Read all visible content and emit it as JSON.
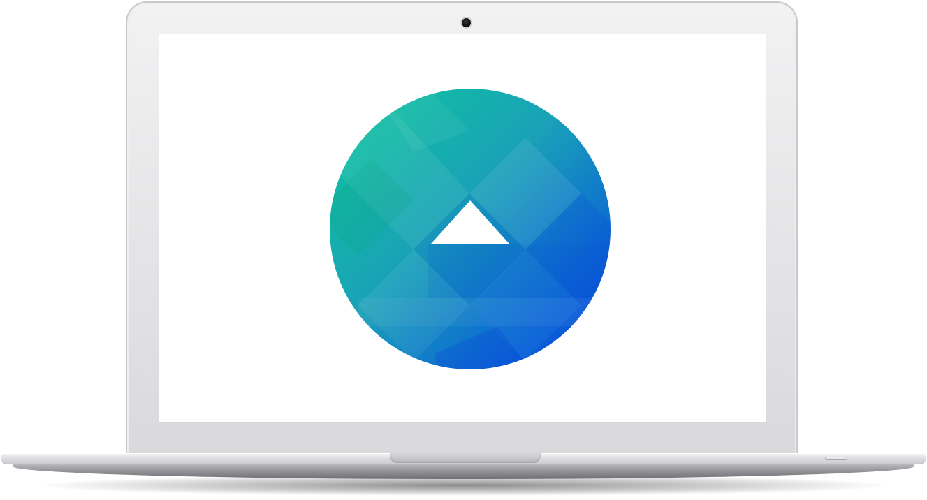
{
  "device": {
    "type": "laptop",
    "bezel_color": "#e4e4e6",
    "screen_background": "#ffffff"
  },
  "screen": {
    "content": "logo",
    "logo": {
      "shape": "circle-with-triangle",
      "icon": "triangle-play-icon",
      "gradient_colors": [
        "#0cc89a",
        "#1aa1b8",
        "#0a63d6",
        "#0a3fd9"
      ],
      "triangle_color": "#ffffff"
    }
  }
}
